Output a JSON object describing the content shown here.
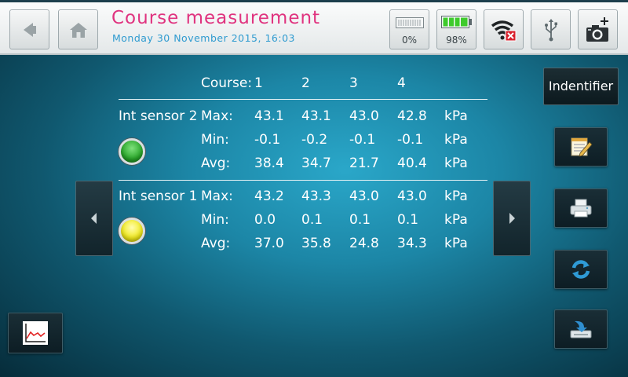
{
  "header": {
    "title": "Course measurement",
    "datetime": "Monday 30 November 2015, 16:03",
    "memory_percent": "0%",
    "battery_percent": "98%"
  },
  "table": {
    "course_label": "Course:",
    "courses": [
      "1",
      "2",
      "3",
      "4"
    ],
    "sensors": [
      {
        "name": "Int sensor 2",
        "led": "green",
        "rows": [
          {
            "label": "Max:",
            "values": [
              "43.1",
              "43.1",
              "43.0",
              "42.8"
            ],
            "unit": "kPa"
          },
          {
            "label": "Min:",
            "values": [
              "-0.1",
              "-0.2",
              "-0.1",
              "-0.1"
            ],
            "unit": "kPa"
          },
          {
            "label": "Avg:",
            "values": [
              "38.4",
              "34.7",
              "21.7",
              "40.4"
            ],
            "unit": "kPa"
          }
        ]
      },
      {
        "name": "Int sensor 1",
        "led": "yellow",
        "rows": [
          {
            "label": "Max:",
            "values": [
              "43.2",
              "43.3",
              "43.0",
              "43.0"
            ],
            "unit": "kPa"
          },
          {
            "label": "Min:",
            "values": [
              "0.0",
              "0.1",
              "0.1",
              "0.1"
            ],
            "unit": "kPa"
          },
          {
            "label": "Avg:",
            "values": [
              "37.0",
              "35.8",
              "24.8",
              "34.3"
            ],
            "unit": "kPa"
          }
        ]
      }
    ]
  },
  "side": {
    "identifier_label": "Indentifier"
  },
  "colors": {
    "title": "#e0337f",
    "subtitle": "#2f9bd0",
    "led_green": "#2aa82a",
    "led_yellow": "#f1ea1c",
    "battery": "#3ecb2c"
  },
  "icons": {
    "back": "arrow-left-icon",
    "home": "home-icon",
    "memory": "memory-bar-icon",
    "battery": "battery-icon",
    "wifi": "wifi-disconnected-icon",
    "usb": "usb-icon",
    "camera": "camera-add-icon",
    "edit": "notepad-pencil-icon",
    "print": "printer-icon",
    "refresh": "refresh-icon",
    "save": "save-tray-icon",
    "graph": "line-graph-icon"
  }
}
